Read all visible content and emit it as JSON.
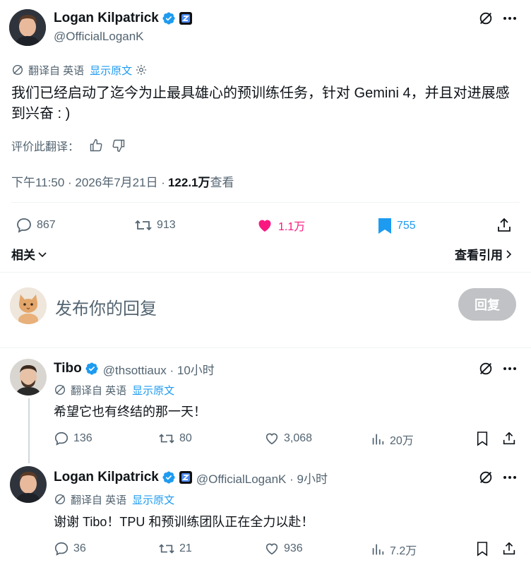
{
  "main_tweet": {
    "author_name": "Logan Kilpatrick",
    "author_handle": "@OfficialLoganK",
    "translation_label": "翻译自 英语",
    "show_original": "显示原文",
    "text": "我们已经启动了迄今为止最具雄心的预训练任务，针对 Gemini 4，并且对进展感到兴奋 : )",
    "rate_translation": "评价此翻译：",
    "timestamp": "下午11:50 · 2026年7月21日 · ",
    "views_count": "122.1万",
    "views_label": " 查看",
    "stats": {
      "replies": "867",
      "retweets": "913",
      "likes": "1.1万",
      "bookmarks": "755"
    },
    "related_label": "相关",
    "view_quotes_label": "查看引用"
  },
  "composer": {
    "placeholder": "发布你的回复",
    "reply_button": "回复"
  },
  "replies": [
    {
      "author_name": "Tibo",
      "author_handle": "@thsottiaux · 10小时",
      "translation_label": "翻译自 英语",
      "show_original": "显示原文",
      "text": "希望它也有终结的那一天！",
      "replies": "136",
      "retweets": "80",
      "likes": "3,068",
      "views": "20万"
    },
    {
      "author_name": "Logan Kilpatrick",
      "author_handle": "@OfficialLoganK · 9小时",
      "translation_label": "翻译自 英语",
      "show_original": "显示原文",
      "text": "谢谢 Tibo！TPU 和预训练团队正在全力以赴！",
      "replies": "36",
      "retweets": "21",
      "likes": "936",
      "views": "7.2万"
    }
  ],
  "colors": {
    "like_active": "#f91880",
    "bookmark_active": "#1d9bf0",
    "link_blue": "#1d9bf0",
    "text_gray": "#536471",
    "reply_button_bg": "#d0d3d5"
  }
}
